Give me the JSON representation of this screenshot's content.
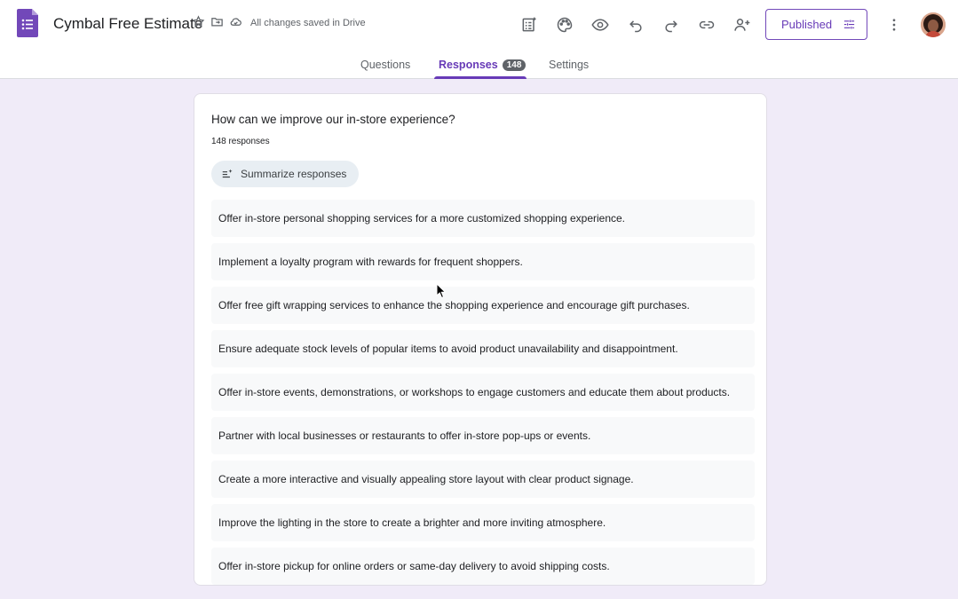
{
  "app": {
    "title": "Cymbal Free Estimate",
    "saved_status": "All changes saved in Drive",
    "accent": "#673ab7"
  },
  "toolbar": {
    "items": [
      {
        "icon": "customize-addon-icon"
      },
      {
        "icon": "palette-icon"
      },
      {
        "icon": "preview-eye-icon"
      },
      {
        "icon": "undo-icon"
      },
      {
        "icon": "redo-icon"
      },
      {
        "icon": "link-icon"
      },
      {
        "icon": "add-collaborator-icon"
      }
    ],
    "publish_label": "Published"
  },
  "tabs": [
    {
      "label": "Questions",
      "active": false
    },
    {
      "label": "Responses",
      "active": true,
      "badge": "148"
    },
    {
      "label": "Settings",
      "active": false
    }
  ],
  "question": {
    "title": "How can we improve our in-store experience?",
    "response_count": "148 responses",
    "summarize_label": "Summarize responses"
  },
  "responses": [
    "Offer in-store personal shopping services for a more customized shopping experience.",
    "Implement a loyalty program with rewards for frequent shoppers.",
    "Offer free gift wrapping services to enhance the shopping experience and encourage gift purchases.",
    "Ensure adequate stock levels of popular items to avoid product unavailability and disappointment.",
    "Offer in-store events, demonstrations, or workshops to engage customers and educate them about products.",
    "Partner with local businesses or restaurants to offer in-store pop-ups or events.",
    "Create a more interactive and visually appealing store layout with clear product signage.",
    "Improve the lighting in the store to create a brighter and more inviting atmosphere.",
    "Offer in-store pickup for online orders or same-day delivery to avoid shipping costs."
  ]
}
